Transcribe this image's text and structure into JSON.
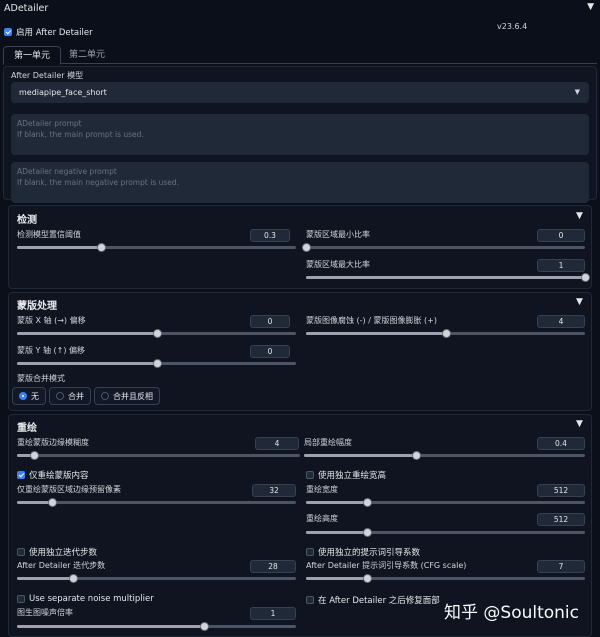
{
  "header": {
    "title": "ADetailer",
    "version": "v23.6.4"
  },
  "enable": {
    "label": "启用 After Detailer",
    "checked": true
  },
  "tabs": [
    {
      "label": "第一单元",
      "active": true
    },
    {
      "label": "第二单元",
      "active": false
    }
  ],
  "model": {
    "label": "After Detailer 模型",
    "value": "mediapipe_face_short"
  },
  "prompt": {
    "placeholder": "ADetailer prompt",
    "hint": "If blank, the main prompt is used."
  },
  "negative_prompt": {
    "placeholder": "ADetailer negative prompt",
    "hint": "If blank, the main negative prompt is used."
  },
  "detection": {
    "title": "检测",
    "confidence": {
      "label": "检测模型置信阈值",
      "value": "0.3",
      "fraction": 0.3
    },
    "mask_min": {
      "label": "蒙版区域最小比率",
      "value": "0",
      "fraction": 0.0
    },
    "mask_max": {
      "label": "蒙版区域最大比率",
      "value": "1",
      "fraction": 1.0
    }
  },
  "mask_processing": {
    "title": "蒙版处理",
    "x_offset": {
      "label": "蒙版 X 轴 (→) 偏移",
      "value": "0",
      "fraction": 0.5
    },
    "erode_dilate": {
      "label": "蒙版图像腐蚀 (-) / 蒙版图像膨胀 (+)",
      "value": "4",
      "fraction": 0.5
    },
    "y_offset": {
      "label": "蒙版 Y 轴 (↑) 偏移",
      "value": "0",
      "fraction": 0.5
    },
    "merge_mode": {
      "label": "蒙版合并模式",
      "options": [
        "无",
        "合并",
        "合并且反相"
      ],
      "selected": 0
    }
  },
  "inpaint": {
    "title": "重绘",
    "mask_blur": {
      "label": "重绘蒙版边缘模糊度",
      "value": "4",
      "fraction": 0.06
    },
    "denoise": {
      "label": "局部重绘幅度",
      "value": "0.4",
      "fraction": 0.4
    },
    "only_masked": {
      "label": "仅重绘蒙版内容",
      "checked": true
    },
    "separate_size": {
      "label": "使用独立重绘宽高",
      "checked": false
    },
    "padding": {
      "label": "仅重绘蒙版区域边缘预留像素",
      "value": "32",
      "fraction": 0.125
    },
    "width": {
      "label": "重绘宽度",
      "value": "512",
      "fraction": 0.22
    },
    "height": {
      "label": "重绘高度",
      "value": "512",
      "fraction": 0.22
    },
    "separate_steps": {
      "label": "使用独立迭代步数",
      "checked": false
    },
    "separate_cfg": {
      "label": "使用独立的提示词引导系数",
      "checked": false
    },
    "steps": {
      "label": "After Detailer 迭代步数",
      "value": "28",
      "fraction": 0.2
    },
    "cfg": {
      "label": "After Detailer 提示词引导系数 (CFG scale)",
      "value": "7",
      "fraction": 0.22
    },
    "noise_mult_toggle": {
      "label": "Use separate noise multiplier",
      "checked": false
    },
    "restore_faces": {
      "label": "在 After Detailer 之后修复面部",
      "checked": false
    },
    "noise_mult": {
      "label": "图生图噪声倍率",
      "value": "1",
      "fraction": 0.67
    }
  },
  "watermark": "知乎 @Soultonic"
}
